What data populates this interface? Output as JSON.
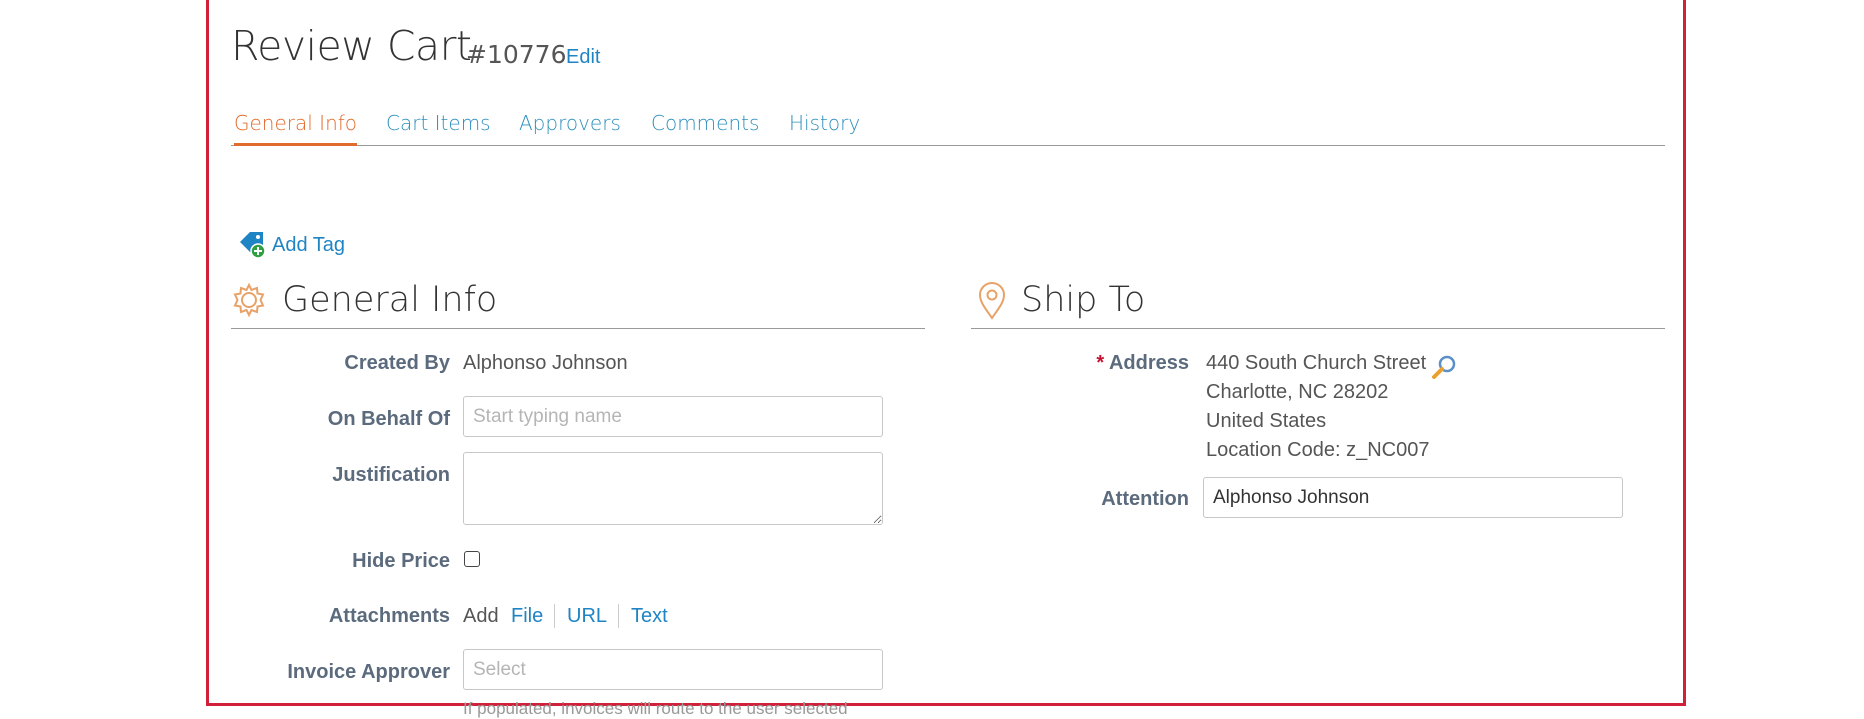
{
  "header": {
    "title": "Review Cart",
    "cart_number": "#10776",
    "edit_label": "Edit"
  },
  "tabs": [
    {
      "label": "General Info",
      "active": true
    },
    {
      "label": "Cart Items",
      "active": false
    },
    {
      "label": "Approvers",
      "active": false
    },
    {
      "label": "Comments",
      "active": false
    },
    {
      "label": "History",
      "active": false
    }
  ],
  "add_tag_label": "Add Tag",
  "general_info": {
    "heading": "General Info",
    "created_by_label": "Created By",
    "created_by_value": "Alphonso Johnson",
    "on_behalf_of_label": "On Behalf Of",
    "on_behalf_of_placeholder": "Start typing name",
    "justification_label": "Justification",
    "hide_price_label": "Hide Price",
    "attachments_label": "Attachments",
    "attachments_add": "Add",
    "attachments_options": [
      "File",
      "URL",
      "Text"
    ],
    "invoice_approver_label": "Invoice Approver",
    "invoice_approver_placeholder": "Select",
    "invoice_approver_hint": "If populated, invoices will route to the user selected"
  },
  "ship_to": {
    "heading": "Ship To",
    "address_required_marker": "*",
    "address_label": "Address",
    "address_lines": [
      "440 South Church Street",
      "Charlotte, NC 28202",
      "United States",
      "Location Code: z_NC007"
    ],
    "attention_label": "Attention",
    "attention_value": "Alphonso Johnson"
  },
  "colors": {
    "frame_border": "#d0203a",
    "link": "#1f84c4",
    "active_tab": "#e06b2c",
    "icon_orange": "#e8a268"
  }
}
